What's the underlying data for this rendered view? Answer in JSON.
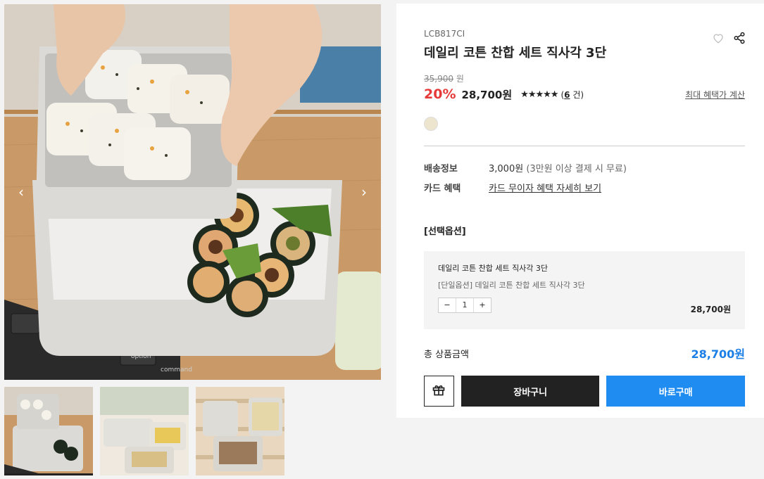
{
  "product": {
    "code": "LCB817CI",
    "title": "데일리 코튼 찬합 세트 직사각 3단",
    "original_price": "35,900",
    "original_unit": "원",
    "discount": "20%",
    "price": "28,700원",
    "stars": "★★★★★",
    "review_open": "(",
    "review_count": "6",
    "review_unit": "건)",
    "benefit_link": "최대 혜택가 계산",
    "rating": 5
  },
  "colors": {
    "swatch": "#eee5cf",
    "accent_red": "#e63a3a",
    "accent_blue": "#1f8cf2",
    "total_blue": "#1b7fe6"
  },
  "meta": {
    "shipping_label": "배송정보",
    "shipping_value": "3,000원",
    "shipping_note": "(3만원 이상 결제 시 무료)",
    "card_label": "카드 혜택",
    "card_link": "카드 무이자 혜택 자세히 보기"
  },
  "options": {
    "title": "[선택옵션]",
    "name": "데일리 코튼 찬합 세트 직사각 3단",
    "sub": "[단일옵션] 데일리 코튼 찬합 세트 직사각 3단",
    "qty": "1",
    "minus": "−",
    "plus": "+",
    "price": "28,700원"
  },
  "total": {
    "label": "총 상품금액",
    "value": "28,700원"
  },
  "actions": {
    "cart": "장바구니",
    "buy": "바로구매"
  },
  "icons": [
    "heart-icon",
    "share-icon",
    "gift-icon",
    "chevron-left-icon",
    "chevron-right-icon"
  ],
  "keyboard_keys": [
    "control",
    "fn",
    "option",
    "command"
  ]
}
